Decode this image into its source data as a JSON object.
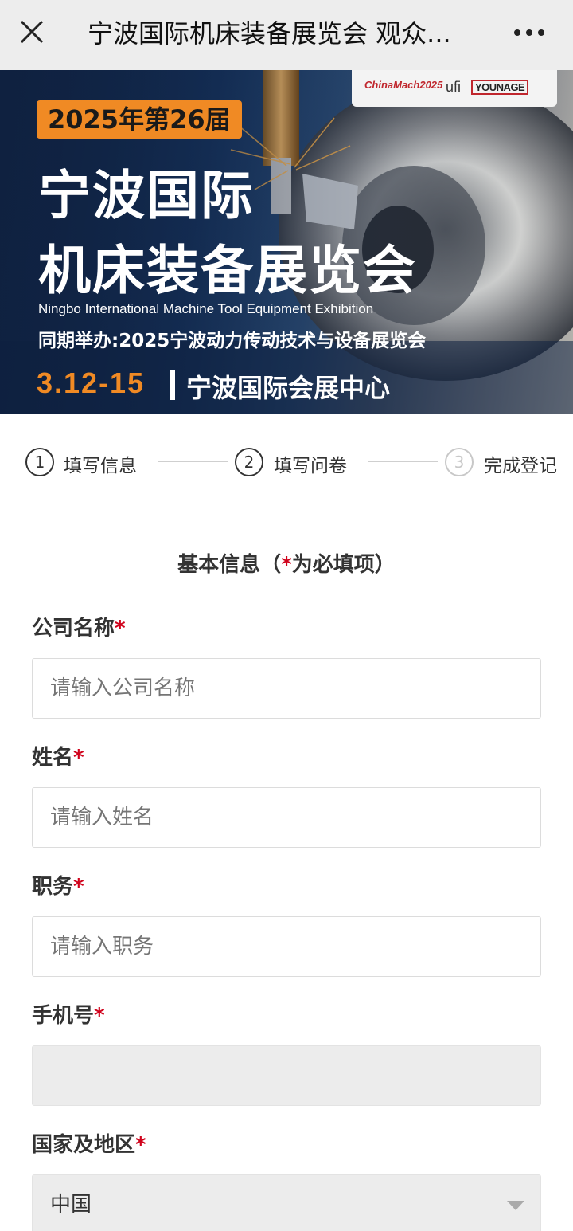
{
  "topbar": {
    "title": "宁波国际机床装备展览会 观众...",
    "close_icon": "close-icon",
    "more_icon": "more-icon"
  },
  "banner": {
    "logos": {
      "chinamach": "ChinaMach2025",
      "ufi": "ufi",
      "younage": "YOUNAGE"
    },
    "edition": "2025年第26届",
    "title_line1": "宁波国际",
    "title_line2": "机床装备展览会",
    "title_en": "Ningbo International Machine Tool Equipment Exhibition",
    "concurrent": "同期举办:2025宁波动力传动技术与设备展览会",
    "dates": "3.12-15",
    "venue": "宁波国际会展中心"
  },
  "steps": [
    {
      "number": "1",
      "label": "填写信息"
    },
    {
      "number": "2",
      "label": "填写问卷"
    },
    {
      "number": "3",
      "label": "完成登记"
    }
  ],
  "form": {
    "section_title": "基本信息（",
    "section_title_star": "*",
    "section_title_tail": "为必填项）",
    "required_mark": "*",
    "company": {
      "label": "公司名称",
      "placeholder": "请输入公司名称"
    },
    "name": {
      "label": "姓名",
      "placeholder": "请输入姓名"
    },
    "position": {
      "label": "职务",
      "placeholder": "请输入职务"
    },
    "phone": {
      "label": "手机号",
      "value": ""
    },
    "country": {
      "label": "国家及地区",
      "selected": "中国"
    }
  },
  "colors": {
    "accent_orange": "#f08a24",
    "required_red": "#d0021b",
    "topbar_bg": "#ededed"
  }
}
